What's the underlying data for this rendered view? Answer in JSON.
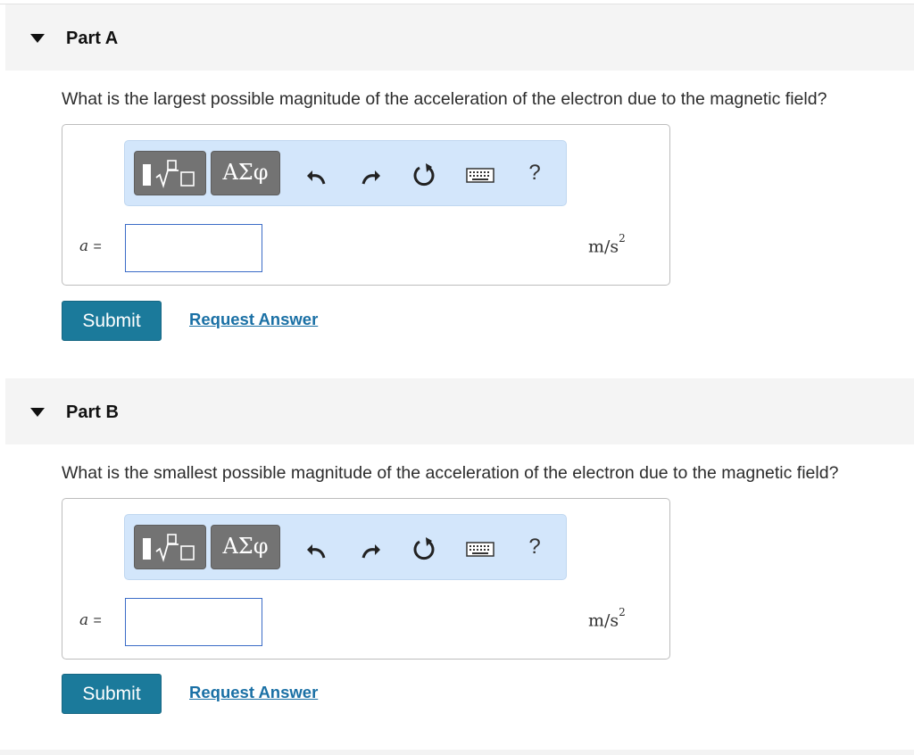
{
  "parts": [
    {
      "title": "Part A",
      "question": "What is the largest possible magnitude of the acceleration of the electron due to the magnetic field?",
      "variable": "a",
      "equals": "=",
      "answer_value": "",
      "unit_base": "m/s",
      "unit_exponent": "2",
      "toolbar": {
        "greek_label": "ΑΣφ",
        "help_label": "?"
      },
      "submit_label": "Submit",
      "request_answer_label": "Request Answer"
    },
    {
      "title": "Part B",
      "question": "What is the smallest possible magnitude of the acceleration of the electron due to the magnetic field?",
      "variable": "a",
      "equals": "=",
      "answer_value": "",
      "unit_base": "m/s",
      "unit_exponent": "2",
      "toolbar": {
        "greek_label": "ΑΣφ",
        "help_label": "?"
      },
      "submit_label": "Submit",
      "request_answer_label": "Request Answer"
    }
  ],
  "icons": [
    "caret-down-icon",
    "templates-icon",
    "undo-icon",
    "redo-icon",
    "reset-icon",
    "keyboard-icon",
    "help-icon"
  ],
  "colors": {
    "submit_bg": "#1b7a9b",
    "link": "#1a70a5",
    "toolbar_bg": "#d3e6fb",
    "input_border": "#3b6cc7",
    "header_bg": "#f4f4f4"
  }
}
